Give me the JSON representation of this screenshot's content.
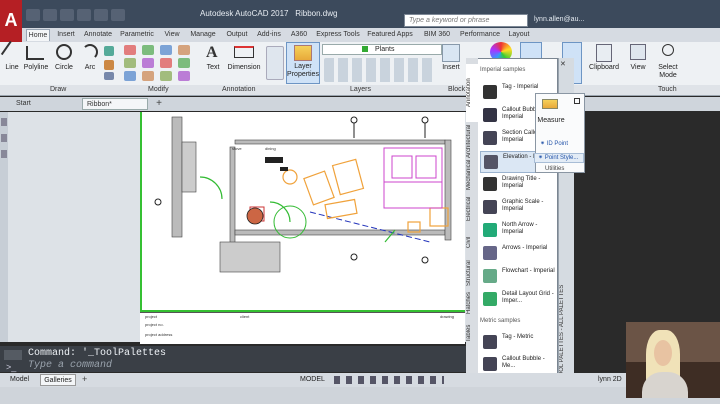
{
  "title_bar": {
    "app_title": "Autodesk AutoCAD 2017",
    "file_name": "Ribbon.dwg",
    "search_placeholder": "Type a keyword or phrase",
    "user": "lynn.allen@au..."
  },
  "ribbon_tabs": [
    "Home",
    "Insert",
    "Annotate",
    "Parametric",
    "View",
    "Manage",
    "Output",
    "Add-ins",
    "A360",
    "Express Tools",
    "Featured Apps",
    "BIM 360",
    "Performance",
    "Layout"
  ],
  "ribbon": {
    "draw_tools": [
      "Line",
      "Polyline",
      "Circle",
      "Arc"
    ],
    "annotation_tools": [
      "Text",
      "Dimension"
    ],
    "layer_tool": "Layer Properties",
    "layer_current": "Plants",
    "other_tools": [
      "Insert",
      "Clipboard",
      "View",
      "Select Mode",
      "Touch"
    ],
    "panels": [
      "Draw",
      "Modify",
      "Annotation",
      "Layers",
      "Block"
    ]
  },
  "doc_tabs": [
    "Start",
    "Ribbon*"
  ],
  "drawing_labels": {
    "hall": "stove",
    "dining": "dining",
    "tb1": "project",
    "tb2": "client",
    "tb3": "drawing",
    "tb4": "project no.",
    "tb5": "project address"
  },
  "palette": {
    "vertical_tabs": [
      "Annotation",
      "Architectural",
      "Mechanical",
      "Electrical",
      "Civil",
      "Structural",
      "Hatches",
      "Tables"
    ],
    "section_imperial": "Imperial samples",
    "section_metric": "Metric samples",
    "items": [
      "Tag - Imperial",
      "Callout Bubble - Imperial",
      "Section Callout - Imperial",
      "Elevation - Imperial",
      "Drawing Title - Imperial",
      "Graphic Scale - Imperial",
      "North Arrow - Imperial",
      "Arrows - Imperial",
      "Flowchart - Imperial",
      "Detail Layout Grid - Imper..."
    ],
    "metric_items": [
      "Tag - Metric",
      "Callout Bubble - Me...",
      "Section"
    ],
    "strip_label": "TOOL PALETTES - ALL PALETTES"
  },
  "flyout": {
    "title": "Measure",
    "items": [
      "ID Point",
      "Point Style..."
    ],
    "footer": "Utilities"
  },
  "command": {
    "history": "Command: '_ToolPalettes",
    "placeholder": "Type a command"
  },
  "status": {
    "layout_tabs": [
      "Model",
      "Galleries"
    ],
    "mode": "MODEL",
    "workspace": "lynn 2D"
  },
  "colors": {
    "accent_red": "#b51f24",
    "titlebar": "#3c4a5c",
    "viewport_border": "#35c032",
    "furniture_orange": "#f0a23b",
    "kitchen_magenta": "#cc44cc"
  }
}
